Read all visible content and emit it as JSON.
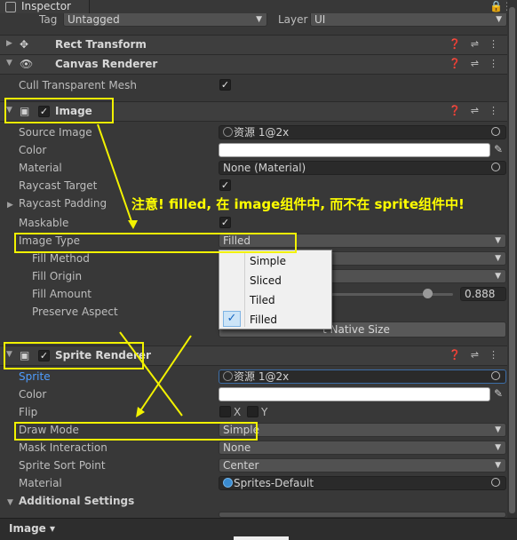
{
  "window": {
    "tab_title": "Inspector"
  },
  "top": {
    "tag_label": "Tag",
    "tag_value": "Untagged",
    "layer_label": "Layer",
    "layer_value": "UI"
  },
  "components": {
    "rect_transform": {
      "title": "Rect Transform"
    },
    "canvas_renderer": {
      "title": "Canvas Renderer",
      "cull_label": "Cull Transparent Mesh"
    },
    "image": {
      "title": "Image",
      "source_image_label": "Source Image",
      "source_image_value": "资源 1@2x",
      "color_label": "Color",
      "material_label": "Material",
      "material_value": "None (Material)",
      "raycast_target_label": "Raycast Target",
      "raycast_padding_label": "Raycast Padding",
      "maskable_label": "Maskable",
      "image_type_label": "Image Type",
      "image_type_value": "Filled",
      "fill_method_label": "Fill Method",
      "fill_origin_label": "Fill Origin",
      "fill_amount_label": "Fill Amount",
      "fill_amount_value": "0.888",
      "preserve_aspect_label": "Preserve Aspect",
      "native_size_button": "Set Native Size",
      "native_size_visible": "t Native Size"
    },
    "sprite_renderer": {
      "title": "Sprite Renderer",
      "sprite_label": "Sprite",
      "sprite_value": "资源 1@2x",
      "color_label": "Color",
      "flip_label": "Flip",
      "flip_x": "X",
      "flip_y": "Y",
      "draw_mode_label": "Draw Mode",
      "draw_mode_value": "Simple",
      "mask_interaction_label": "Mask Interaction",
      "mask_interaction_value": "None",
      "sort_point_label": "Sprite Sort Point",
      "sort_point_value": "Center",
      "material_label": "Material",
      "material_value": "Sprites-Default"
    },
    "additional_settings": {
      "title": "Additional Settings"
    }
  },
  "dropdown_menu": {
    "options": [
      "Simple",
      "Sliced",
      "Tiled",
      "Filled"
    ],
    "selected": "Filled"
  },
  "annotation": {
    "note": "注意! filled, 在 image组件中, 而不在 sprite组件中!"
  },
  "bottom": {
    "label": "Image ▾"
  },
  "colors": {
    "highlight": "#f2f200",
    "accent": "#4f9cff"
  }
}
